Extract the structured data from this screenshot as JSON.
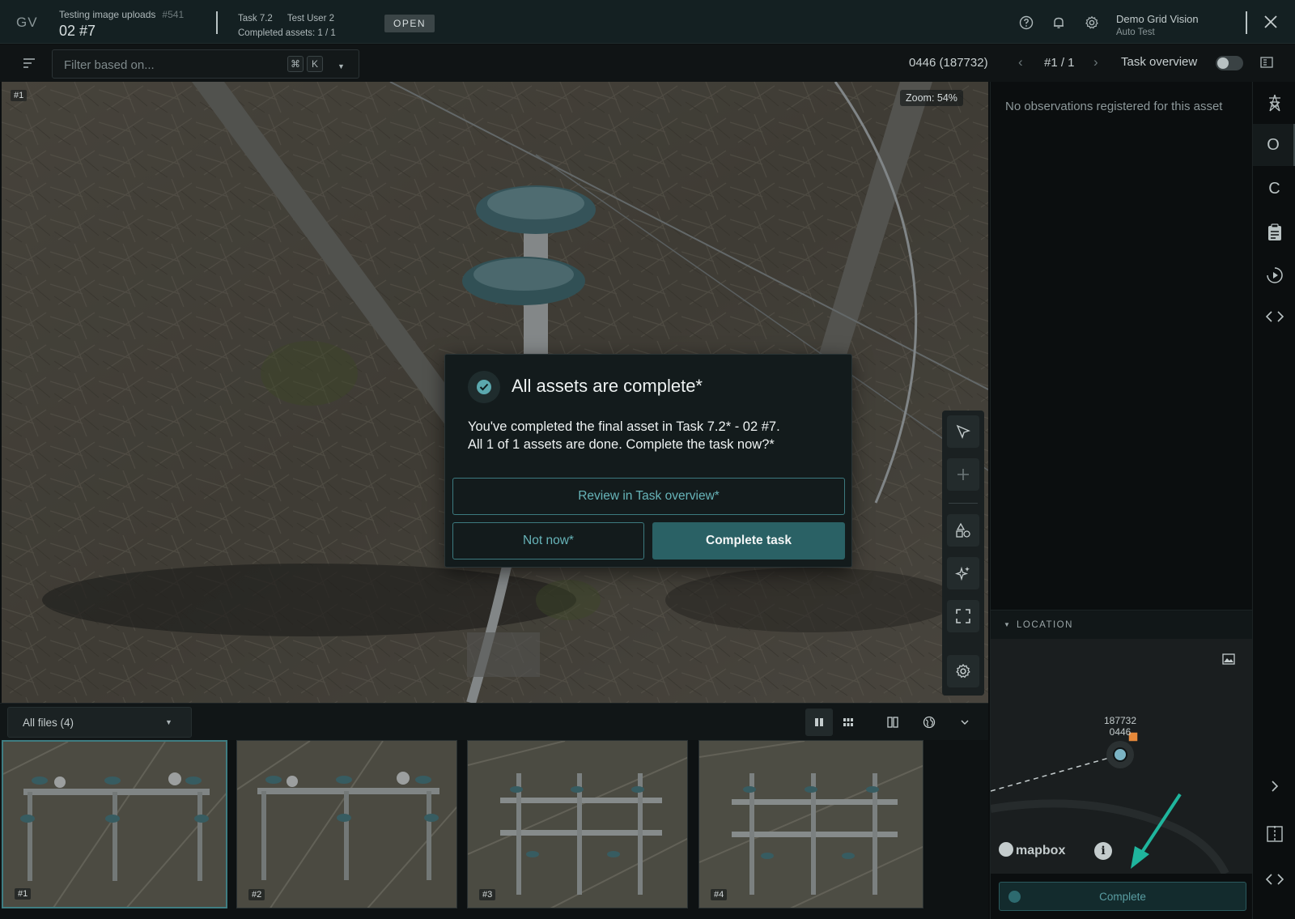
{
  "header": {
    "logo": "GV",
    "project_name": "Testing image uploads",
    "project_number": "#541",
    "project_title": "02 #7",
    "task": "Task 7.2",
    "assignee": "Test User 2",
    "completed_assets": "Completed assets: 1 / 1",
    "status_badge": "OPEN",
    "user_name": "Demo Grid Vision",
    "user_org": "Auto Test"
  },
  "toolbar": {
    "filter_placeholder": "Filter based on...",
    "shortcut_cmd": "⌘",
    "shortcut_key": "K",
    "asset_id": "0446 (187732)",
    "nav_count": "#1 / 1",
    "task_overview_label": "Task overview",
    "task_overview_enabled": false
  },
  "viewer": {
    "image_tag": "#1",
    "zoom": "Zoom: 54%"
  },
  "modal": {
    "title": "All assets are complete*",
    "body_line1": "You've completed the final asset in Task 7.2* - 02 #7.",
    "body_line2": "All 1 of 1 assets are done. Complete the task now?*",
    "review_button": "Review in Task overview*",
    "not_now_button": "Not now*",
    "complete_button": "Complete task"
  },
  "strip": {
    "files_filter": "All files (4)",
    "thumbnails": [
      {
        "tag": "#1",
        "selected": true
      },
      {
        "tag": "#2",
        "selected": false
      },
      {
        "tag": "#3",
        "selected": false
      },
      {
        "tag": "#4",
        "selected": false
      }
    ]
  },
  "right_panel": {
    "no_observations": "No observations registered for this asset",
    "location_title": "LOCATION",
    "map_label_id": "187732",
    "map_label_asset": "0446",
    "map_attribution": "mapbox",
    "complete_button": "Complete"
  },
  "rail": {
    "items": [
      {
        "label": "",
        "icon": "tower-icon"
      },
      {
        "label": "O",
        "icon": "observations"
      },
      {
        "label": "C",
        "icon": "comments"
      },
      {
        "label": "",
        "icon": "clipboard-icon"
      },
      {
        "label": "",
        "icon": "history-icon"
      },
      {
        "label": "",
        "icon": "code-icon"
      }
    ]
  },
  "colors": {
    "accent": "#2a6165",
    "accent_text": "#67b4b9",
    "header_bg": "#142022",
    "annotation_arrow": "#1fb59d"
  }
}
